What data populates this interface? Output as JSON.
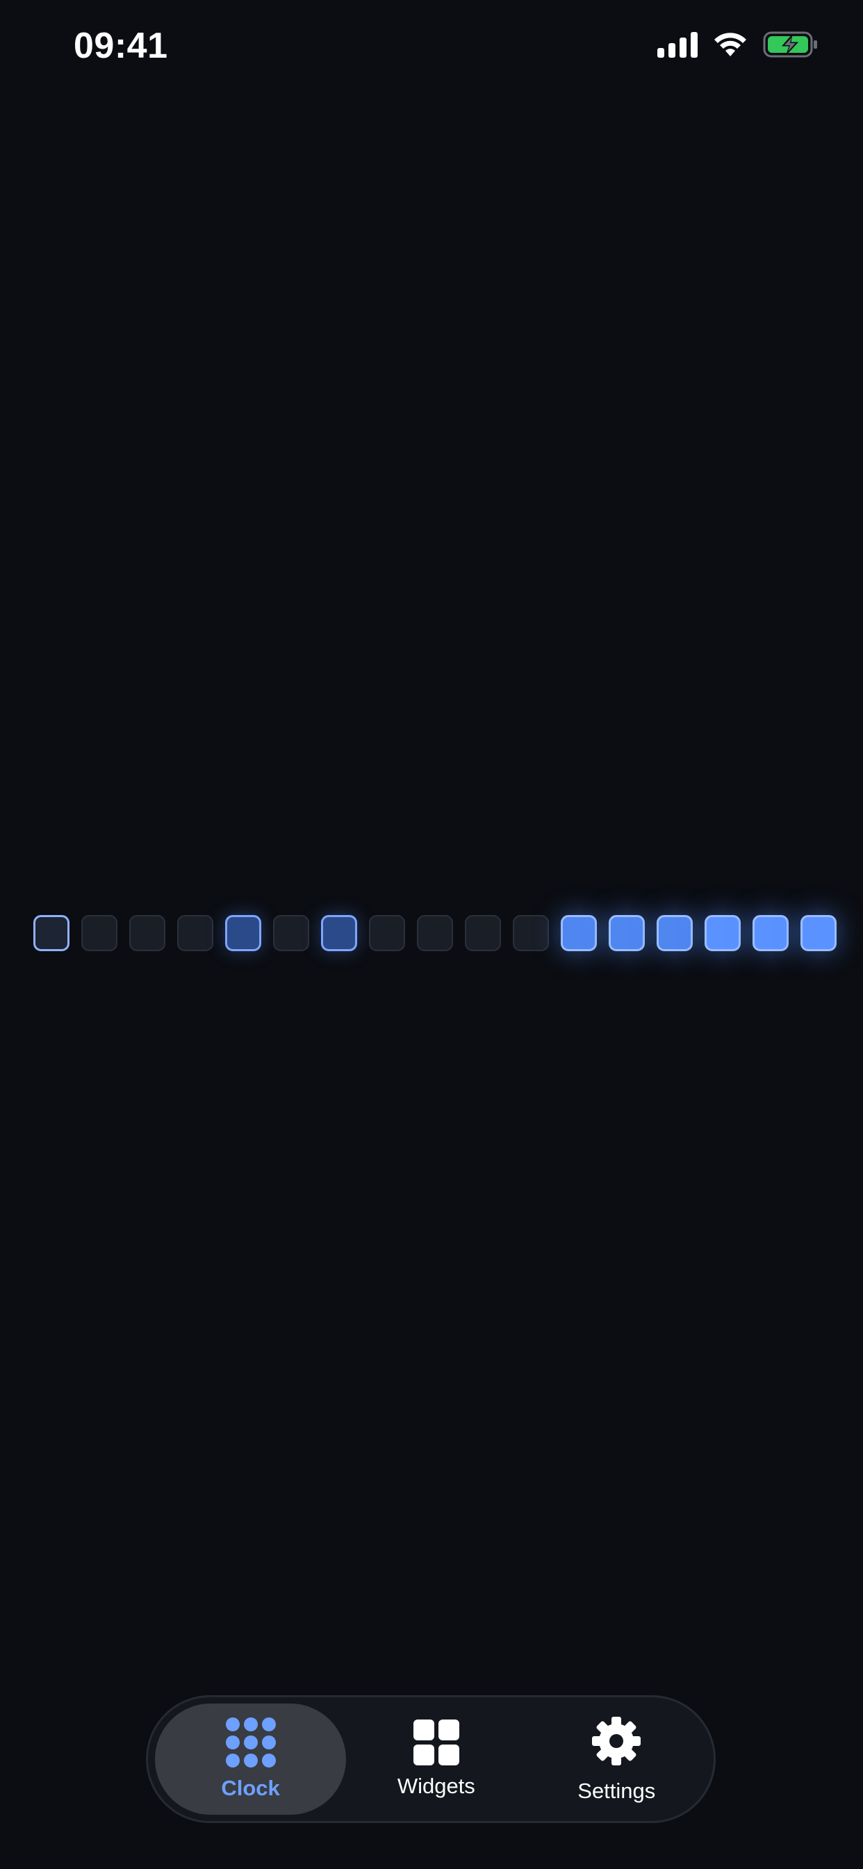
{
  "status_bar": {
    "time": "09:41",
    "icons": [
      "cellular-signal-icon",
      "wifi-icon",
      "battery-charging-icon"
    ]
  },
  "binary_clock": {
    "bits": [
      1,
      0,
      0,
      0,
      1,
      0,
      1,
      0,
      0,
      0,
      0,
      1,
      1,
      1,
      1,
      1,
      1
    ],
    "on_color": "#4f86f0",
    "off_color": "#1a1e27"
  },
  "tab_bar": {
    "tabs": [
      {
        "label": "Clock",
        "icon": "dots-grid-icon",
        "active": true
      },
      {
        "label": "Widgets",
        "icon": "widgets-grid-icon",
        "active": false
      },
      {
        "label": "Settings",
        "icon": "gear-icon",
        "active": false
      }
    ],
    "accent_color": "#6ea0ff"
  }
}
